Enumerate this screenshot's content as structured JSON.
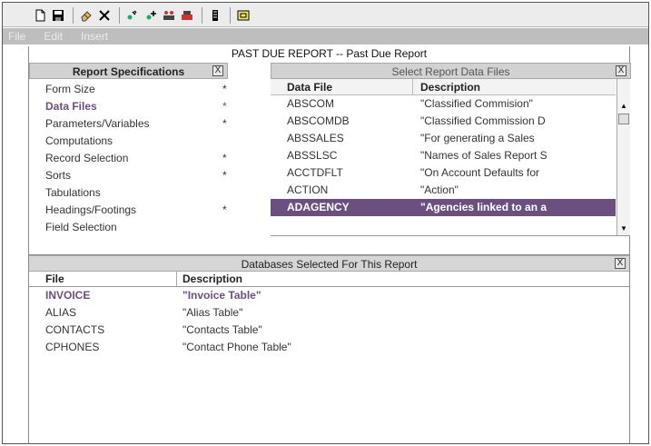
{
  "toolbar": {
    "buttons": [
      "new-document",
      "save",
      "eraser",
      "delete",
      "edit-data",
      "add-data",
      "add-tables",
      "remove-tables",
      "report-layout",
      "properties"
    ]
  },
  "menu": [
    "File",
    "Edit",
    "Insert"
  ],
  "report_title": "PAST DUE REPORT -- Past Due Report",
  "specs_panel": {
    "title": "Report Specifications",
    "close": "X",
    "items": [
      {
        "label": "Form Size",
        "flag": "*"
      },
      {
        "label": "Data Files",
        "flag": "*",
        "selected": true
      },
      {
        "label": "Parameters/Variables",
        "flag": "*"
      },
      {
        "label": "Computations",
        "flag": ""
      },
      {
        "label": "Record Selection",
        "flag": "*"
      },
      {
        "label": "Sorts",
        "flag": "*"
      },
      {
        "label": "Tabulations",
        "flag": ""
      },
      {
        "label": "Headings/Footings",
        "flag": "*"
      },
      {
        "label": "Field Selection",
        "flag": ""
      }
    ]
  },
  "files_panel": {
    "title": "Select Report Data Files",
    "close": "X",
    "col_file": "Data File",
    "col_desc": "Description",
    "rows": [
      {
        "file": "ABSCOM",
        "desc": "\"Classified Commision\""
      },
      {
        "file": "ABSCOMDB",
        "desc": "\"Classified Commission D"
      },
      {
        "file": "ABSSALES",
        "desc": "\"For generating a Sales"
      },
      {
        "file": "ABSSLSC",
        "desc": "\"Names of Sales Report S"
      },
      {
        "file": "ACCTDFLT",
        "desc": "\"On Account Defaults for"
      },
      {
        "file": "ACTION",
        "desc": "\"Action\""
      },
      {
        "file": "ADAGENCY",
        "desc": "\"Agencies linked to an a",
        "selected": true
      }
    ]
  },
  "dbs_panel": {
    "title": "Databases Selected For This Report",
    "close": "X",
    "col_file": "File",
    "col_desc": "Description",
    "rows": [
      {
        "file": "INVOICE",
        "desc": "\"Invoice Table\"",
        "active": true
      },
      {
        "file": "ALIAS",
        "desc": "\"Alias Table\""
      },
      {
        "file": "CONTACTS",
        "desc": "\"Contacts Table\""
      },
      {
        "file": "CPHONES",
        "desc": "\"Contact Phone Table\""
      }
    ]
  },
  "colors": {
    "selection": "#6b4f7e",
    "menubar": "#bebebe"
  }
}
